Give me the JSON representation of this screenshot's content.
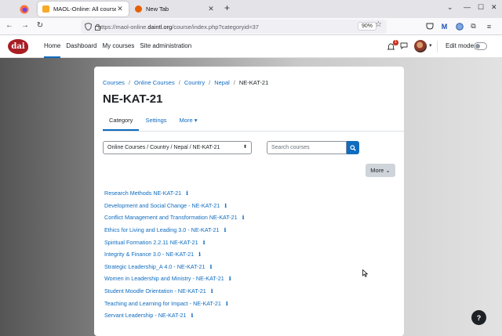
{
  "browser": {
    "tabs": [
      {
        "title": "MAOL-Online: All courses",
        "active": true,
        "favicon_color": "#f7a928"
      },
      {
        "title": "New Tab",
        "active": false,
        "favicon_color": "#e66000"
      }
    ],
    "url_prefix": "https://maol-online.",
    "url_host": "daintl.org",
    "url_path": "/course/index.php?categoryid=37",
    "zoom": "90%"
  },
  "site": {
    "logo_text": "dai",
    "nav": [
      {
        "label": "Home",
        "active": true
      },
      {
        "label": "Dashboard",
        "active": false
      },
      {
        "label": "My courses",
        "active": false
      },
      {
        "label": "Site administration",
        "active": false
      }
    ],
    "notification_count": "1",
    "edit_mode_label": "Edit mode"
  },
  "page": {
    "breadcrumb": [
      "Courses",
      "Online Courses",
      "Country",
      "Nepal",
      "NE-KAT-21"
    ],
    "title": "NE-KAT-21",
    "tabs": [
      {
        "label": "Category",
        "active": true
      },
      {
        "label": "Settings",
        "active": false
      },
      {
        "label": "More ▾",
        "active": false
      }
    ],
    "category_select": "Online Courses / Country / Nepal / NE-KAT-21",
    "search_placeholder": "Search courses",
    "more_button": "More ⌄",
    "courses": [
      "Research Methods NE-KAT-21",
      "Development and Social Change - NE-KAT-21",
      "Conflict Management and Transformation NE-KAT-21",
      "Ethics for Living and Leading 3.0 - NE-KAT-21",
      "Spiritual Formation 2.2.11 NE-KAT-21",
      "Integrity & Finance 3.0 - NE-KAT-21",
      "Strategic Leadership_A 4.0 - NE-KAT-21",
      "Women in Leadership and Ministry - NE-KAT-21",
      "Student Moodle Orientation - NE-KAT-21",
      "Teaching and Learning for Impact - NE-KAT-21",
      "Servant Leadership - NE-KAT-21"
    ],
    "info_glyph": "i",
    "help_glyph": "?"
  }
}
